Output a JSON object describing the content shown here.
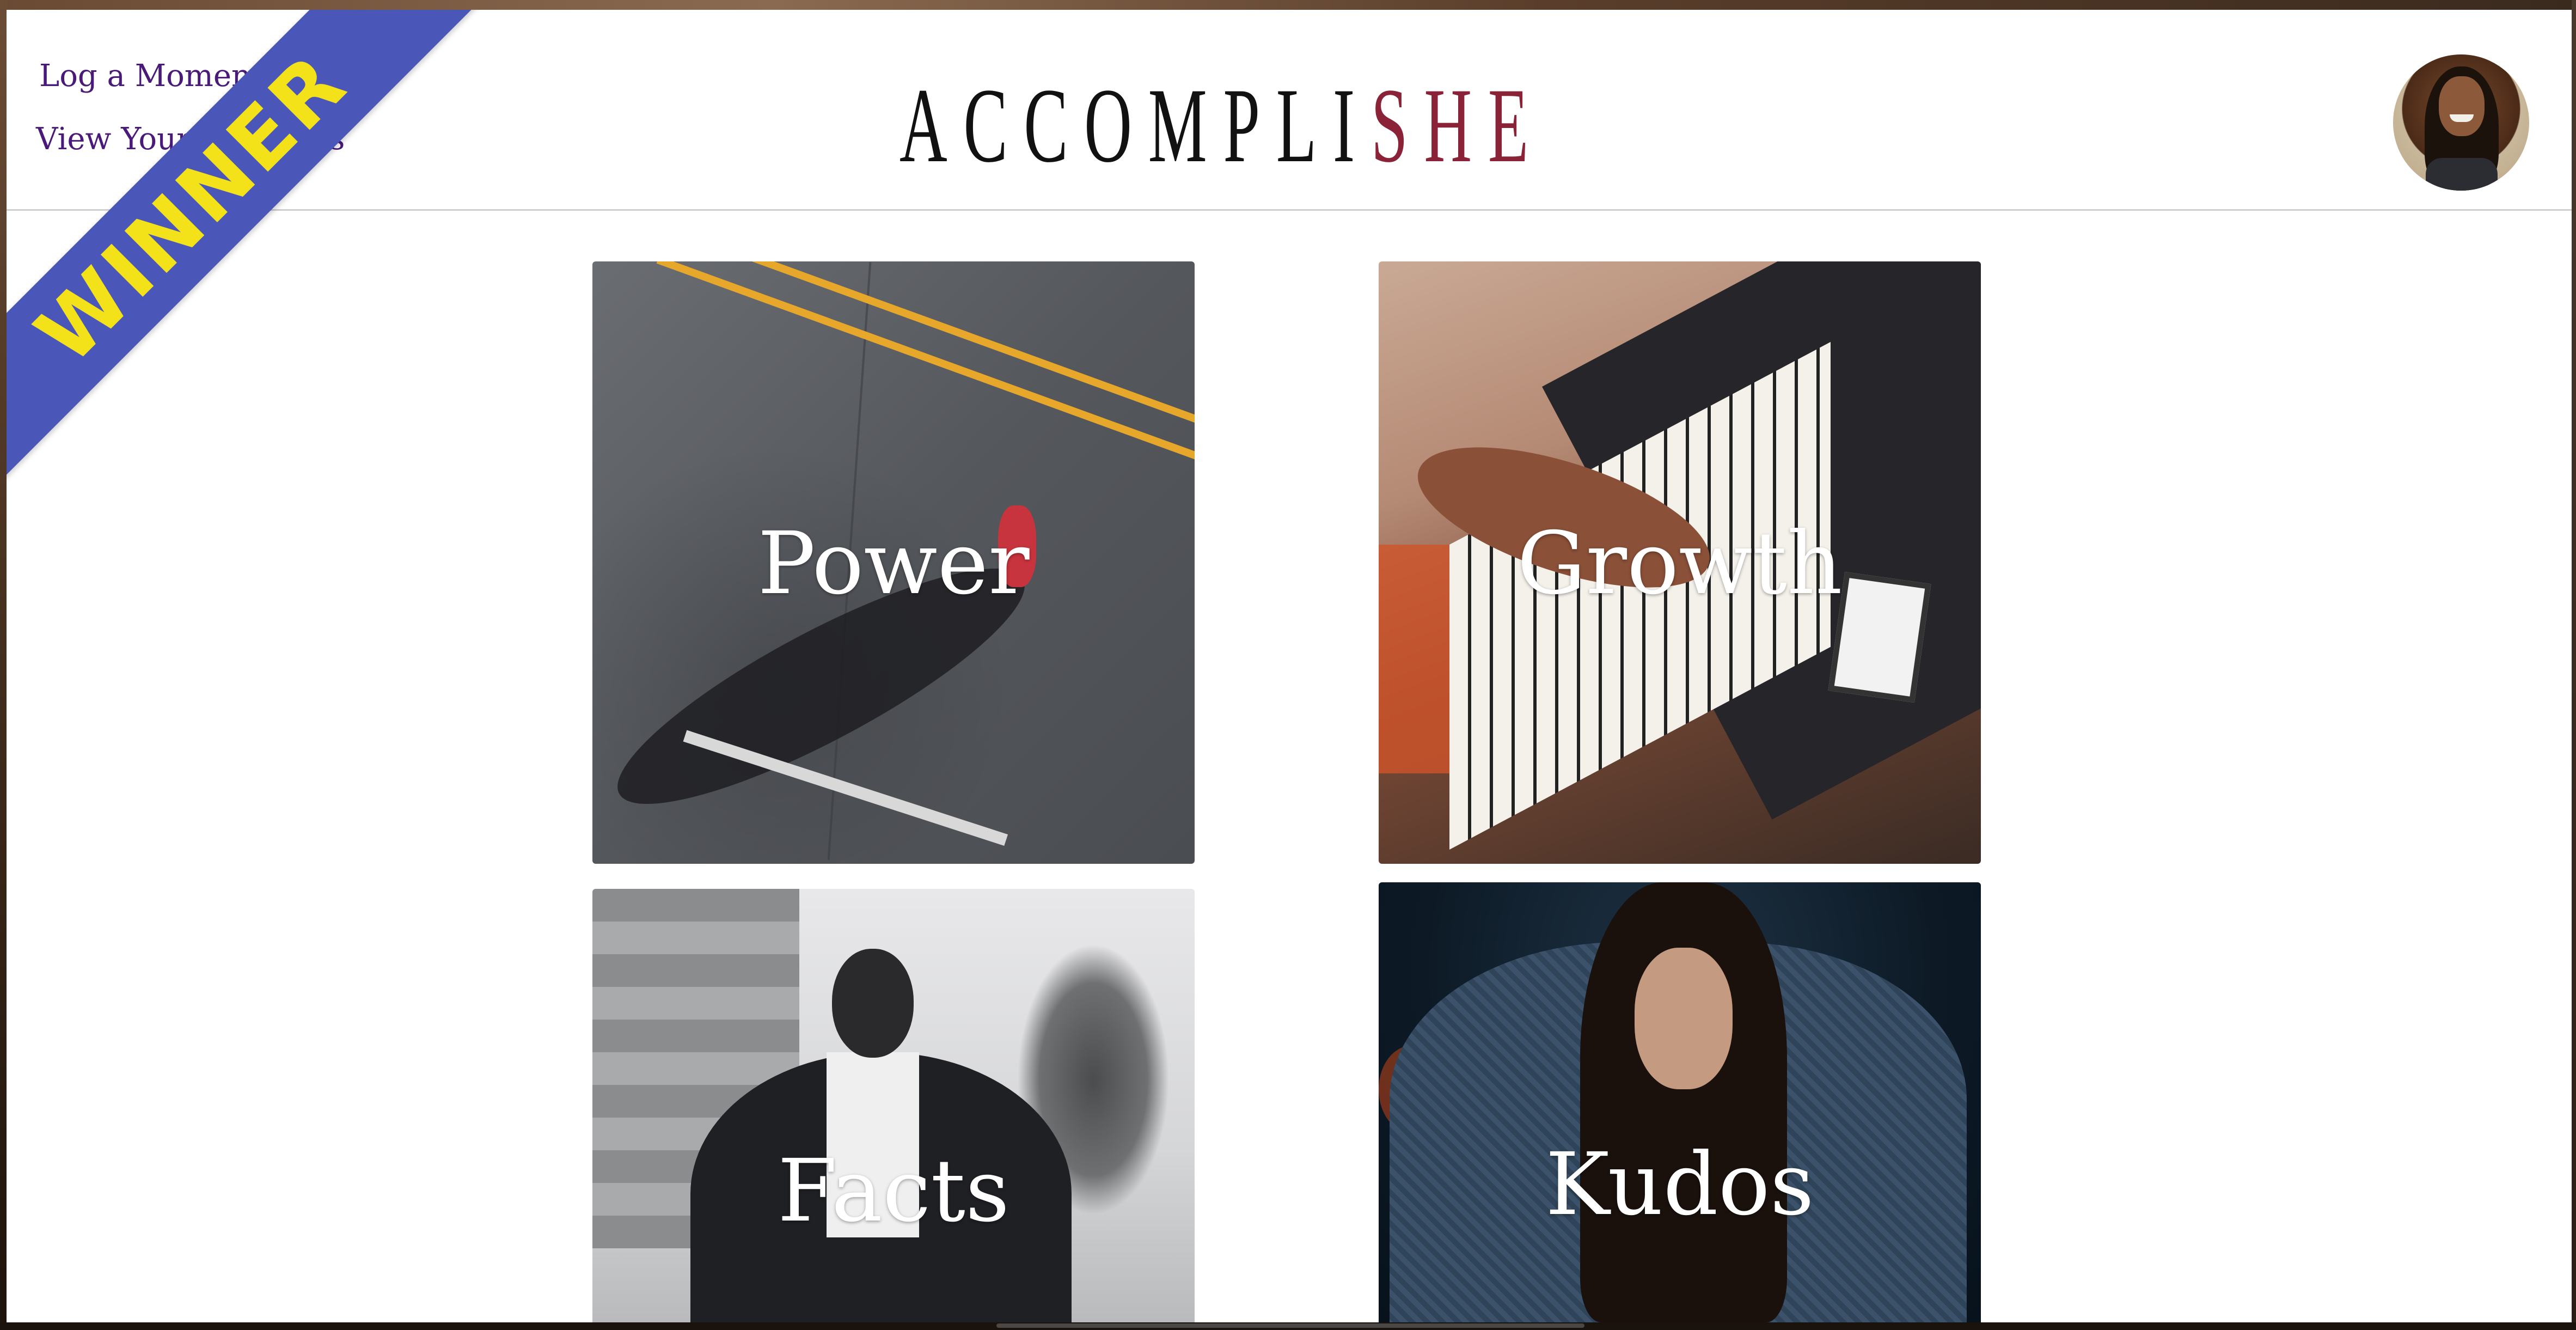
{
  "nav": {
    "log_moment": "Log a Moment",
    "view_yours": "View Your Moments"
  },
  "logo": {
    "part1": "ACCOMPLI",
    "part2": "SHE"
  },
  "banner": {
    "text": "WINNER",
    "bg_color": "#4b57b8",
    "text_color": "#f3e21a"
  },
  "tiles": [
    {
      "label": "Power"
    },
    {
      "label": "Growth"
    },
    {
      "label": "Facts"
    },
    {
      "label": "Kudos"
    }
  ],
  "colors": {
    "link": "#4a1a7a",
    "logo_dark": "#111111",
    "logo_accent": "#8a2338"
  },
  "avatar": {
    "icon": "profile-photo"
  }
}
